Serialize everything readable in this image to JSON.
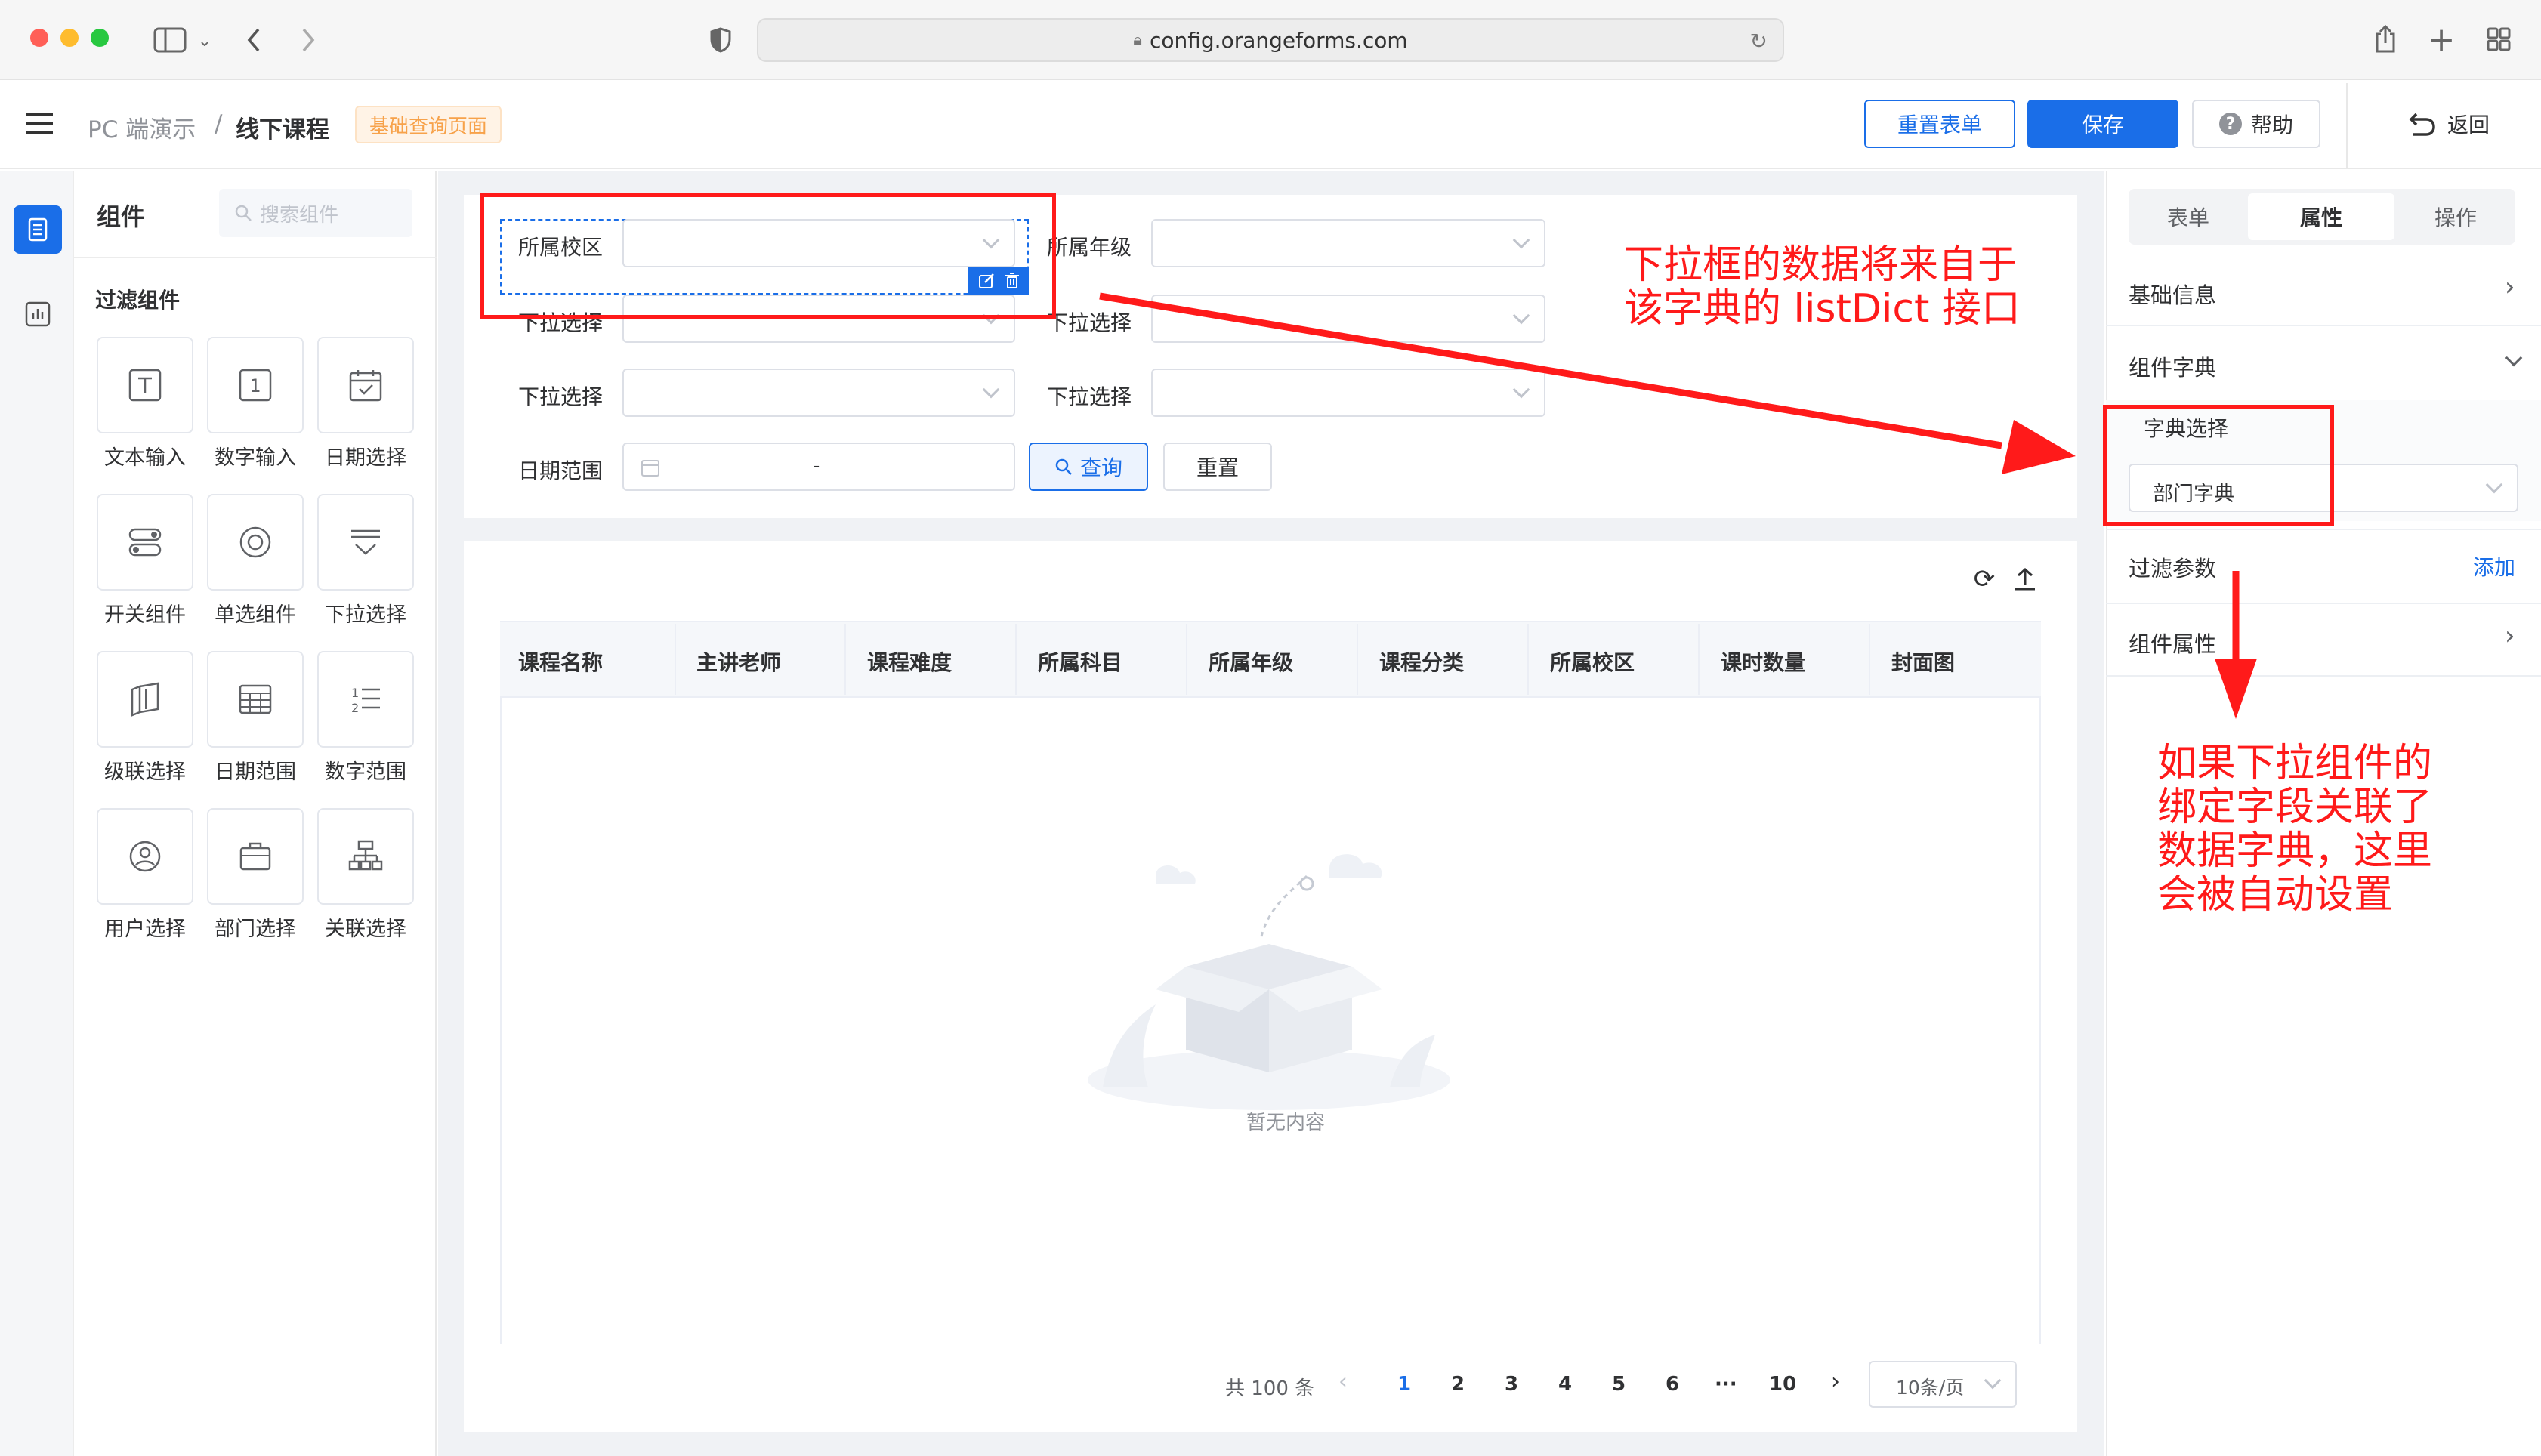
{
  "browser": {
    "url": "config.orangeforms.com"
  },
  "header": {
    "breadcrumb_root": "PC 端演示",
    "breadcrumb_sep": "/",
    "breadcrumb_current": "线下课程",
    "page_tag": "基础查询页面",
    "reset_form_label": "重置表单",
    "save_label": "保存",
    "help_label": "帮助",
    "back_label": "返回"
  },
  "palette": {
    "title": "组件",
    "search_placeholder": "搜索组件",
    "section_title": "过滤组件",
    "items": [
      {
        "label": "文本输入",
        "icon": "text-input-icon"
      },
      {
        "label": "数字输入",
        "icon": "number-input-icon"
      },
      {
        "label": "日期选择",
        "icon": "date-picker-icon"
      },
      {
        "label": "开关组件",
        "icon": "switch-icon"
      },
      {
        "label": "单选组件",
        "icon": "radio-icon"
      },
      {
        "label": "下拉选择",
        "icon": "dropdown-icon"
      },
      {
        "label": "级联选择",
        "icon": "cascader-icon"
      },
      {
        "label": "日期范围",
        "icon": "date-range-icon"
      },
      {
        "label": "数字范围",
        "icon": "number-range-icon"
      },
      {
        "label": "用户选择",
        "icon": "user-select-icon"
      },
      {
        "label": "部门选择",
        "icon": "dept-select-icon"
      },
      {
        "label": "关联选择",
        "icon": "relation-select-icon"
      }
    ]
  },
  "filter_form": {
    "fields": [
      {
        "label": "所属校区"
      },
      {
        "label": "所属年级"
      },
      {
        "label": "下拉选择"
      },
      {
        "label": "下拉选择"
      },
      {
        "label": "下拉选择"
      },
      {
        "label": "下拉选择"
      }
    ],
    "date_range_label": "日期范围",
    "date_range_sep": "-",
    "query_label": "查询",
    "reset_label": "重置"
  },
  "table": {
    "columns": [
      "课程名称",
      "主讲老师",
      "课程难度",
      "所属科目",
      "所属年级",
      "课程分类",
      "所属校区",
      "课时数量",
      "封面图"
    ],
    "empty_text": "暂无内容"
  },
  "pagination": {
    "total_text": "共 100 条",
    "pages": [
      "1",
      "2",
      "3",
      "4",
      "5",
      "6",
      "···",
      "10"
    ],
    "current_page": "1",
    "page_size": "10条/页"
  },
  "right_panel": {
    "tabs": [
      "表单",
      "属性",
      "操作"
    ],
    "active_tab": "属性",
    "sections": {
      "basic_info": "基础信息",
      "component_dict": "组件字典",
      "dict_select_label": "字典选择",
      "dict_select_value": "部门字典",
      "filter_params": "过滤参数",
      "add_label": "添加",
      "component_props": "组件属性"
    }
  },
  "annotations": {
    "top_note_line1": "下拉框的数据将来自于",
    "top_note_line2": "该字典的 listDict 接口",
    "bottom_note_lines": [
      "如果下拉组件的",
      "绑定字段关联了",
      "数据字典，这里",
      "会被自动设置"
    ]
  },
  "colors": {
    "primary": "#1a6ee8",
    "annotation_red": "#ff1a1a",
    "tag_orange": "#f7a24a"
  }
}
